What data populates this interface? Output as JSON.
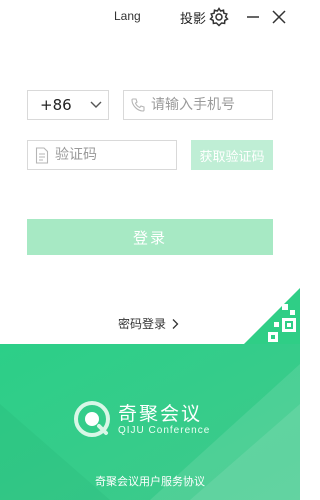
{
  "header": {
    "language_label": "Lang",
    "cast_label": "投影"
  },
  "icons": {
    "settings": "gear-icon",
    "minimize": "minimize-icon",
    "close": "close-icon",
    "dropdown": "chevron-down-icon",
    "phone": "phone-icon",
    "code": "document-icon",
    "qr": "qr-code-icon"
  },
  "form": {
    "country_code": "+86",
    "phone_placeholder": "请输入手机号",
    "code_placeholder": "验证码",
    "get_code_label": "获取验证码",
    "login_label": "登录",
    "password_login_label": "密码登录"
  },
  "brand": {
    "name": "奇聚会议",
    "subtitle": "QIJU Conference"
  },
  "footer": {
    "agreement_label": "奇聚会议用户服务协议"
  },
  "colors": {
    "accent": "#2fce86",
    "button_disabled": "#a7e9c4",
    "footer_green": "#36c985"
  }
}
